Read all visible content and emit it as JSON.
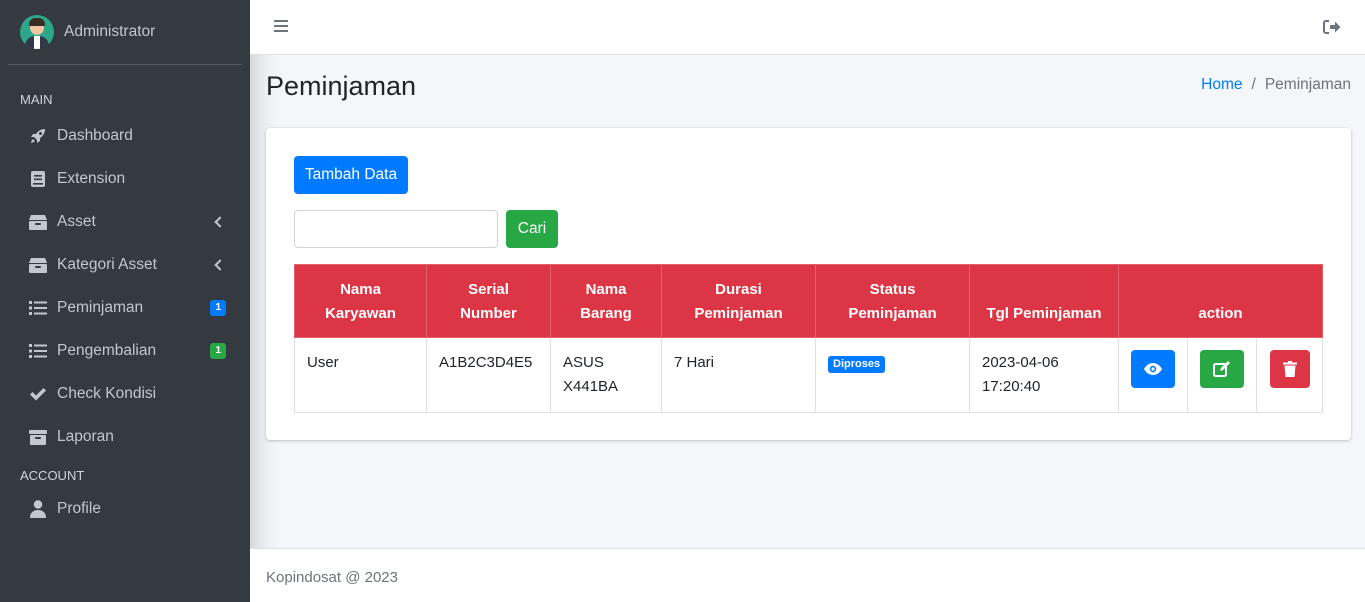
{
  "sidebar": {
    "user_name": "Administrator",
    "section_main": "MAIN",
    "section_account": "ACCOUNT",
    "items": [
      {
        "label": "Dashboard",
        "icon": "rocket-icon"
      },
      {
        "label": "Extension",
        "icon": "book-icon"
      },
      {
        "label": "Asset",
        "icon": "box-icon",
        "expandable": true
      },
      {
        "label": "Kategori Asset",
        "icon": "box-icon",
        "expandable": true
      },
      {
        "label": "Peminjaman",
        "icon": "list-icon",
        "badge": "1",
        "badge_color": "#007bff"
      },
      {
        "label": "Pengembalian",
        "icon": "list-icon",
        "badge": "1",
        "badge_color": "#28a745"
      },
      {
        "label": "Check Kondisi",
        "icon": "check-icon"
      },
      {
        "label": "Laporan",
        "icon": "archive-icon"
      }
    ],
    "account_items": [
      {
        "label": "Profile",
        "icon": "user-icon"
      }
    ]
  },
  "header": {
    "menu_icon": "hamburger-icon",
    "logout_icon": "sign-out-icon"
  },
  "page": {
    "title": "Peminjaman",
    "breadcrumb": {
      "home": "Home",
      "current": "Peminjaman"
    }
  },
  "card": {
    "add_button": "Tambah Data",
    "search_value": "",
    "search_button": "Cari"
  },
  "table": {
    "columns": [
      {
        "line1": "Nama",
        "line2": "Karyawan"
      },
      {
        "line1": "Serial",
        "line2": "Number"
      },
      {
        "line1": "Nama",
        "line2": "Barang"
      },
      {
        "line1": "Durasi",
        "line2": "Peminjaman"
      },
      {
        "line1": "Status",
        "line2": "Peminjaman"
      },
      {
        "line1": "",
        "line2": "Tgl Peminjaman"
      },
      {
        "line1": "",
        "line2": "action"
      }
    ],
    "rows": [
      {
        "nama_karyawan": "User",
        "serial_number": "A1B2C3D4E5",
        "nama_barang_1": "ASUS",
        "nama_barang_2": "X441BA",
        "durasi": "7 Hari",
        "status": "Diproses",
        "tgl_1": "2023-04-06",
        "tgl_2": "17:20:40",
        "actions": [
          "eye-icon",
          "edit-icon",
          "trash-icon"
        ]
      }
    ]
  },
  "footer": {
    "text": "Kopindosat @ 2023"
  },
  "colors": {
    "sidebar_bg": "#343a40",
    "primary": "#007bff",
    "success": "#28a745",
    "danger": "#dc3545"
  }
}
